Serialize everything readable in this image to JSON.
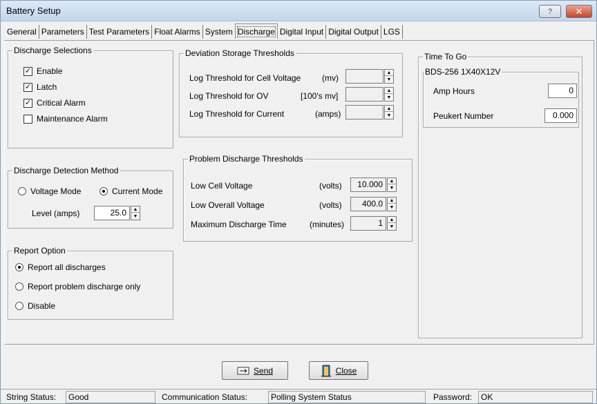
{
  "window": {
    "title": "Battery Setup",
    "help_label": "?",
    "close_label": "✕"
  },
  "tabs": [
    {
      "label": "General"
    },
    {
      "label": "Parameters"
    },
    {
      "label": "Test Parameters"
    },
    {
      "label": "Float Alarms"
    },
    {
      "label": "System"
    },
    {
      "label": "Discharge"
    },
    {
      "label": "Digital Input"
    },
    {
      "label": "Digital Output"
    },
    {
      "label": "LGS"
    }
  ],
  "active_tab": "Discharge",
  "discharge_selections": {
    "title": "Discharge Selections",
    "items": [
      {
        "label": "Enable",
        "checked": true,
        "mark": "✓"
      },
      {
        "label": "Latch",
        "checked": true,
        "mark": "✓"
      },
      {
        "label": "Critical Alarm",
        "checked": true,
        "mark": "✓"
      },
      {
        "label": "Maintenance Alarm",
        "checked": false,
        "mark": ""
      }
    ]
  },
  "detection": {
    "title": "Discharge Detection Method",
    "voltage_label": "Voltage Mode",
    "current_label": "Current Mode",
    "selected": "Current Mode",
    "level_label": "Level  (amps)",
    "level_value": "25.0"
  },
  "report": {
    "title": "Report Option",
    "options": [
      {
        "label": "Report all discharges",
        "selected": true
      },
      {
        "label": "Report problem discharge only",
        "selected": false
      },
      {
        "label": "Disable",
        "selected": false
      }
    ]
  },
  "deviation": {
    "title": "Deviation Storage Thresholds",
    "rows": [
      {
        "label": "Log Threshold for Cell Voltage",
        "unit": "(mv)",
        "value": ""
      },
      {
        "label": "Log Threshold for OV",
        "unit": "[100's mv]",
        "value": ""
      },
      {
        "label": "Log Threshold for Current",
        "unit": "(amps)",
        "value": ""
      }
    ]
  },
  "problem": {
    "title": "Problem Discharge Thresholds",
    "rows": [
      {
        "label": "Low Cell Voltage",
        "unit": "(volts)",
        "value": "10.000"
      },
      {
        "label": "Low Overall Voltage",
        "unit": "(volts)",
        "value": "400.0"
      },
      {
        "label": "Maximum Discharge Time",
        "unit": "(minutes)",
        "value": "1"
      }
    ]
  },
  "time_to_go": {
    "title": "Time To Go",
    "battery_title": "BDS-256 1X40X12V",
    "amp_hours_label": "Amp Hours",
    "amp_hours_value": "0",
    "peukert_label": "Peukert Number",
    "peukert_value": "0.000"
  },
  "buttons": {
    "send": "Send",
    "close": "Close"
  },
  "status": {
    "string_label": "String Status:",
    "string_value": "Good",
    "comm_label": "Communication Status:",
    "comm_value": "Polling System Status",
    "password_label": "Password:",
    "password_value": "OK"
  }
}
